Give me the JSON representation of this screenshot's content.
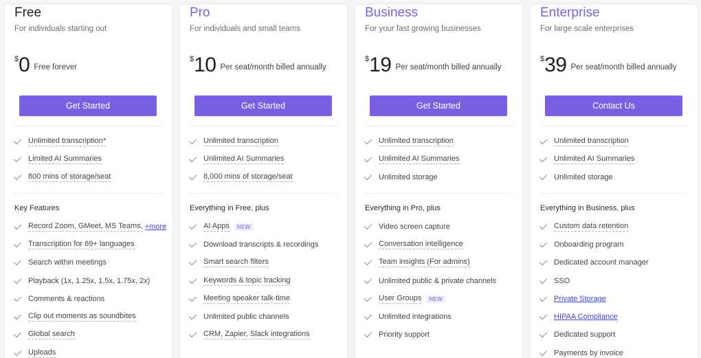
{
  "plans": [
    {
      "name": "Free",
      "description": "For individuals starting out",
      "currency": "$",
      "price": "0",
      "price_note": "Free forever",
      "cta": "Get Started",
      "basics": [
        {
          "text": "Unlimited transcription*"
        },
        {
          "text": "Limited AI Summaries"
        },
        {
          "text": "800 mins of storage/seat"
        }
      ],
      "section_title": "Key Features",
      "features": [
        {
          "text": "Record Zoom, GMeet, MS Teams,",
          "more": "+more"
        },
        {
          "text": "Transcription for 69+ languages"
        },
        {
          "text": "Search within meetings"
        },
        {
          "text": "Playback (1x, 1.25x, 1.5x, 1.75x, 2x)"
        },
        {
          "text": "Comments & reactions"
        },
        {
          "text": "Clip out moments as soundbites"
        },
        {
          "text": "Global search"
        },
        {
          "text": "Uploads"
        }
      ]
    },
    {
      "name": "Pro",
      "description": "For individuals and small teams",
      "currency": "$",
      "price": "10",
      "price_note": "Per seat/month billed annually",
      "cta": "Get Started",
      "basics": [
        {
          "text": "Unlimited transcription"
        },
        {
          "text": "Unlimited AI Summaries"
        },
        {
          "text": "8,000 mins of storage/seat"
        }
      ],
      "section_title": "Everything in Free, plus",
      "features": [
        {
          "text": "AI Apps",
          "badge": "NEW"
        },
        {
          "text": "Download transcripts & recordings"
        },
        {
          "text": "Smart search filters"
        },
        {
          "text": "Keywords & topic tracking"
        },
        {
          "text": "Meeting speaker talk-time"
        },
        {
          "text": "Unlimited public channels"
        },
        {
          "text": "CRM, Zapier, Slack integrations"
        }
      ]
    },
    {
      "name": "Business",
      "description": "For your fast growing businesses",
      "currency": "$",
      "price": "19",
      "price_note": "Per seat/month billed annually",
      "cta": "Get Started",
      "basics": [
        {
          "text": "Unlimited transcription"
        },
        {
          "text": "Unlimited AI Summaries"
        },
        {
          "text": "Unlimited storage"
        }
      ],
      "section_title": "Everything in Pro, plus",
      "features": [
        {
          "text": "Video screen capture"
        },
        {
          "text": "Conversation intelligence"
        },
        {
          "text": "Team insights (For admins)"
        },
        {
          "text": "Unlimited public & private channels"
        },
        {
          "text": "User Groups",
          "badge": "NEW"
        },
        {
          "text": "Unlimited integrations"
        },
        {
          "text": "Priority support"
        }
      ]
    },
    {
      "name": "Enterprise",
      "description": "For large scale enterprises",
      "currency": "$",
      "price": "39",
      "price_note": "Per seat/month billed annually",
      "cta": "Contact Us",
      "basics": [
        {
          "text": "Unlimited transcription"
        },
        {
          "text": "Unlimited AI Summaries"
        },
        {
          "text": "Unlimited storage"
        }
      ],
      "section_title": "Everything in Business, plus",
      "features": [
        {
          "text": "Custom data retention"
        },
        {
          "text": "Onboarding program"
        },
        {
          "text": "Dedicated account manager"
        },
        {
          "text": "SSO"
        },
        {
          "text": "Private Storage"
        },
        {
          "text": "HIPAA Compliance"
        },
        {
          "text": "Dedicated support"
        },
        {
          "text": "Payments by invoice"
        }
      ]
    }
  ],
  "colors": {
    "accent": "#7b5fe3",
    "plan_name_accent": "#7d62e6",
    "link": "#3c46c9"
  }
}
